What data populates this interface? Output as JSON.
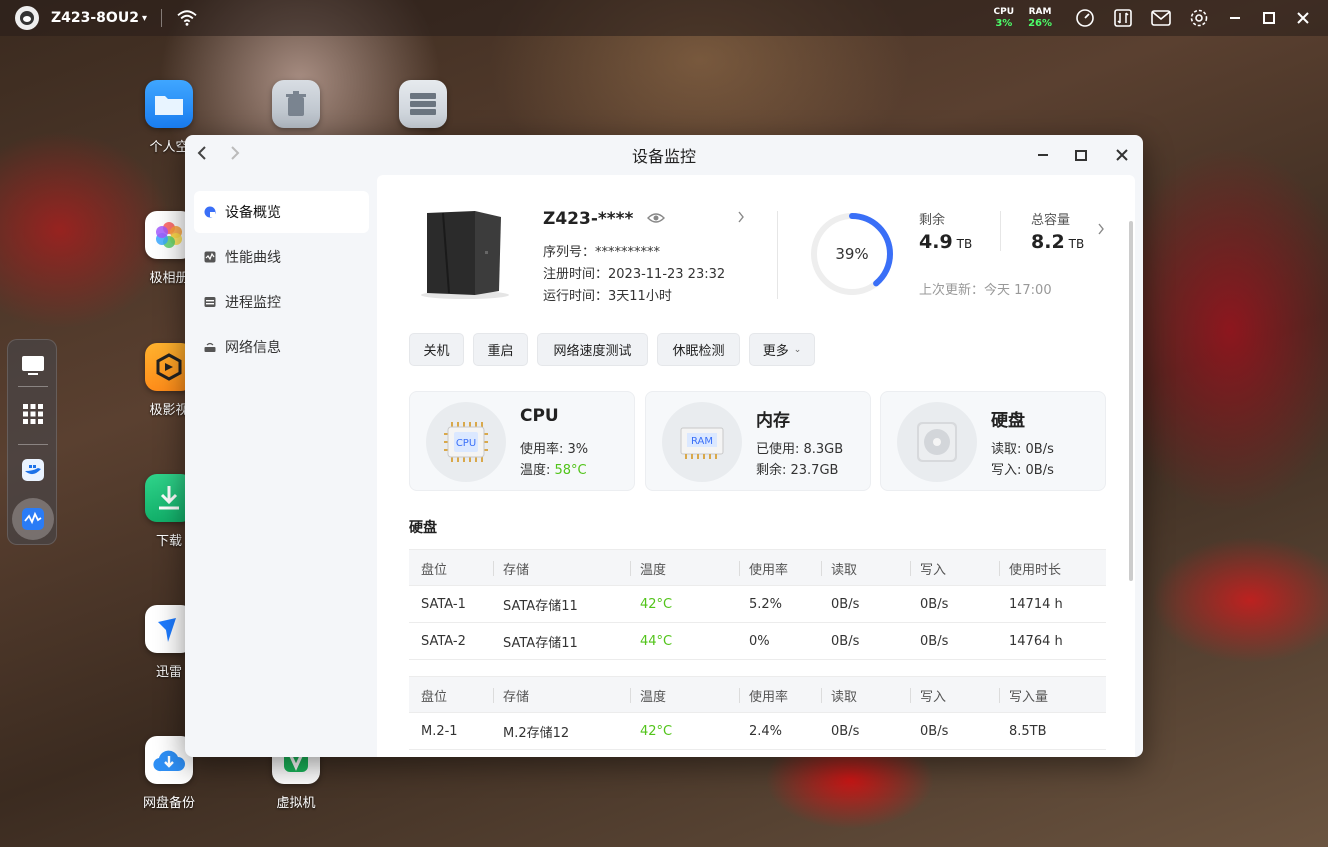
{
  "topbar": {
    "device": "Z423-8OU2",
    "cpu_label": "CPU",
    "cpu_value": "3%",
    "ram_label": "RAM",
    "ram_value": "26%"
  },
  "desktop": {
    "icons": [
      {
        "label": "个人空",
        "name": "personal-space"
      },
      {
        "label": "极相册",
        "name": "photo-album"
      },
      {
        "label": "极影视",
        "name": "video"
      },
      {
        "label": "下载",
        "name": "download"
      },
      {
        "label": "迅雷",
        "name": "xunlei"
      },
      {
        "label": "网盘备份",
        "name": "cloud-backup"
      },
      {
        "label": "虚拟机",
        "name": "virtual-machine"
      }
    ]
  },
  "window": {
    "title": "设备监控",
    "sidebar": [
      {
        "label": "设备概览",
        "icon": "overview-icon"
      },
      {
        "label": "性能曲线",
        "icon": "chart-icon"
      },
      {
        "label": "进程监控",
        "icon": "process-icon"
      },
      {
        "label": "网络信息",
        "icon": "network-icon"
      }
    ],
    "device": {
      "name": "Z423-****",
      "serial": "序列号：**********",
      "registered": "注册时间：2023-11-23 23:32",
      "uptime": "运行时间：3天11小时"
    },
    "storage": {
      "percent": "39%",
      "percent_value": 39,
      "remain_label": "剩余",
      "remain_value": "4.9",
      "remain_unit": "TB",
      "total_label": "总容量",
      "total_value": "8.2",
      "total_unit": "TB",
      "last_update": "上次更新：今天 17:00"
    },
    "buttons": {
      "shutdown": "关机",
      "restart": "重启",
      "speedtest": "网络速度测试",
      "sleep": "休眠检测",
      "more": "更多"
    },
    "cards": {
      "cpu": {
        "title": "CPU",
        "usage_label": "使用率: ",
        "usage": "3%",
        "temp_label": "温度: ",
        "temp": "58°C",
        "chip": "CPU"
      },
      "mem": {
        "title": "内存",
        "used": "已使用: 8.3GB",
        "remain": "剩余: 23.7GB",
        "chip": "RAM"
      },
      "disk": {
        "title": "硬盘",
        "read": "读取: 0B/s",
        "write": "写入: 0B/s"
      }
    },
    "disk_section_title": "硬盘",
    "sata_table": {
      "headers": [
        "盘位",
        "存储",
        "温度",
        "使用率",
        "读取",
        "写入",
        "使用时长"
      ],
      "rows": [
        [
          "SATA-1",
          "SATA存储11",
          "42°C",
          "5.2%",
          "0B/s",
          "0B/s",
          "14714 h"
        ],
        [
          "SATA-2",
          "SATA存储11",
          "44°C",
          "0%",
          "0B/s",
          "0B/s",
          "14764 h"
        ]
      ]
    },
    "m2_table": {
      "headers": [
        "盘位",
        "存储",
        "温度",
        "使用率",
        "读取",
        "写入",
        "写入量"
      ],
      "rows": [
        [
          "M.2-1",
          "M.2存储12",
          "42°C",
          "2.4%",
          "0B/s",
          "0B/s",
          "8.5TB"
        ]
      ]
    }
  },
  "colors": {
    "accent": "#3a6ff7",
    "temp_green": "#52c41a",
    "stat_green": "#4cff6a"
  }
}
